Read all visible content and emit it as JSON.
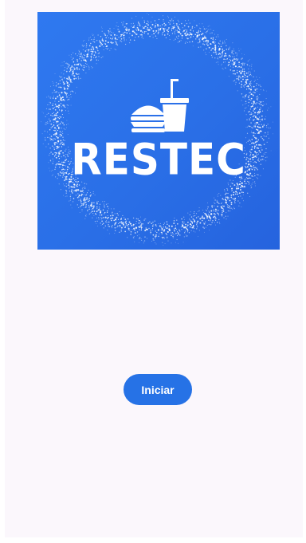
{
  "splash": {
    "logo": {
      "title": "RESTEC",
      "icons": [
        "burger-icon",
        "drink-cup-icon"
      ],
      "background_color": "#2a6fe7",
      "foreground_color": "#ffffff"
    },
    "start_button": {
      "label": "Iniciar",
      "color": "#2672e6"
    },
    "background_color": "#fbf7fc"
  }
}
